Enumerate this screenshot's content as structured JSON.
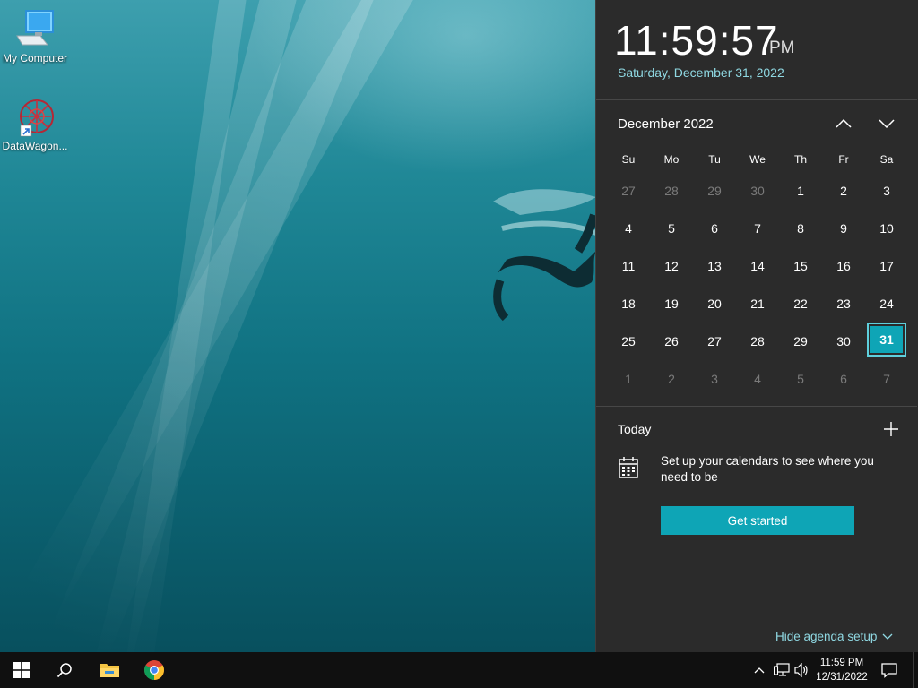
{
  "desktop": {
    "icons": [
      {
        "label": "My Computer"
      },
      {
        "label": "DataWagon..."
      }
    ]
  },
  "flyout": {
    "time": "11:59:57",
    "ampm": "PM",
    "date": "Saturday, December 31, 2022",
    "month_label": "December 2022",
    "weekdays": [
      "Su",
      "Mo",
      "Tu",
      "We",
      "Th",
      "Fr",
      "Sa"
    ],
    "weeks": [
      [
        "27",
        "28",
        "29",
        "30",
        "1",
        "2",
        "3"
      ],
      [
        "4",
        "5",
        "6",
        "7",
        "8",
        "9",
        "10"
      ],
      [
        "11",
        "12",
        "13",
        "14",
        "15",
        "16",
        "17"
      ],
      [
        "18",
        "19",
        "20",
        "21",
        "22",
        "23",
        "24"
      ],
      [
        "25",
        "26",
        "27",
        "28",
        "29",
        "30",
        "31"
      ],
      [
        "1",
        "2",
        "3",
        "4",
        "5",
        "6",
        "7"
      ]
    ],
    "today_label": "Today",
    "agenda_text": "Set up your calendars to see where you need to be",
    "get_started": "Get started",
    "hide_agenda": "Hide agenda setup"
  },
  "taskbar": {
    "tray_time": "11:59 PM",
    "tray_date": "12/31/2022"
  },
  "colors": {
    "accent": "#0ea5b6",
    "flyout_bg": "#2b2b2b",
    "taskbar_bg": "#101010"
  }
}
